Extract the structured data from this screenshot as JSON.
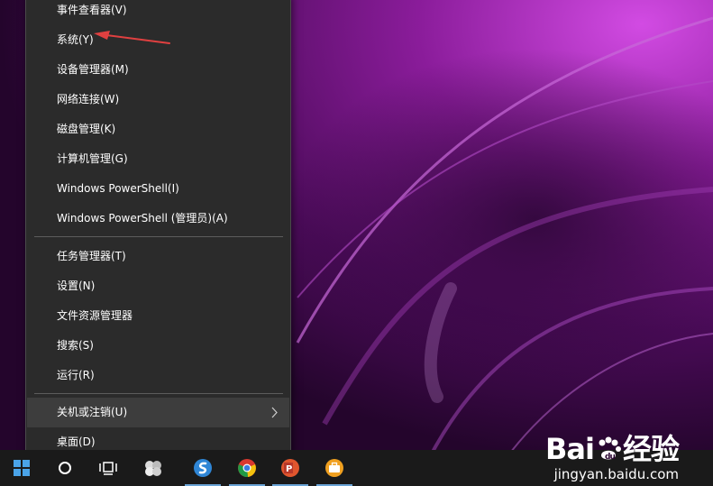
{
  "menu": {
    "items": [
      {
        "label": "事件查看器(V)"
      },
      {
        "label": "系统(Y)"
      },
      {
        "label": "设备管理器(M)"
      },
      {
        "label": "网络连接(W)"
      },
      {
        "label": "磁盘管理(K)"
      },
      {
        "label": "计算机管理(G)"
      },
      {
        "label": "Windows PowerShell(I)"
      },
      {
        "label": "Windows PowerShell (管理员)(A)"
      },
      {
        "label": "任务管理器(T)"
      },
      {
        "label": "设置(N)"
      },
      {
        "label": "文件资源管理器"
      },
      {
        "label": "搜索(S)"
      },
      {
        "label": "运行(R)"
      },
      {
        "label": "关机或注销(U)",
        "has_submenu": true,
        "highlighted": true
      },
      {
        "label": "桌面(D)"
      }
    ]
  },
  "taskbar": {
    "icons": [
      "windows-start-icon",
      "cortana-search-icon",
      "task-view-icon",
      "app-icon",
      "sogou-icon",
      "chrome-icon",
      "powerpoint-icon",
      "briefcase-app-icon"
    ]
  },
  "watermark": {
    "logo_text": "Bai",
    "logo_text_tail": "经验",
    "url": "jingyan.baidu.com"
  },
  "colors": {
    "menu_bg": "#2b2b2b",
    "menu_highlight": "#3d3d3d",
    "annotation_arrow": "#e04040",
    "taskbar_bg": "#1a1a1a"
  }
}
